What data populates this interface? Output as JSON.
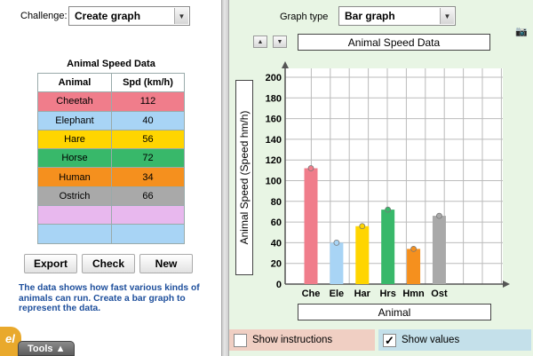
{
  "left": {
    "challenge_label": "Challenge:",
    "challenge_value": "Create graph",
    "table_title": "Animal Speed Data",
    "columns": [
      "Animal",
      "Spd (km/h)"
    ],
    "rows": [
      {
        "animal": "Cheetah",
        "speed": "112",
        "color": "#f07d8b"
      },
      {
        "animal": "Elephant",
        "speed": "40",
        "color": "#a8d4f5"
      },
      {
        "animal": "Hare",
        "speed": "56",
        "color": "#ffd500"
      },
      {
        "animal": "Horse",
        "speed": "72",
        "color": "#38b86a"
      },
      {
        "animal": "Human",
        "speed": "34",
        "color": "#f5901e"
      },
      {
        "animal": "Ostrich",
        "speed": "66",
        "color": "#a9a9a9"
      },
      {
        "animal": "",
        "speed": "",
        "color": "#e8b8ee"
      },
      {
        "animal": "",
        "speed": "",
        "color": "#a8d4f5"
      }
    ],
    "buttons": {
      "export": "Export",
      "check": "Check",
      "new": "New"
    },
    "description": "The data shows how fast various kinds of animals can run. Create a bar graph to represent the data.",
    "tools_label": "Tools ▲",
    "logo": "el"
  },
  "right": {
    "graph_type_label": "Graph type",
    "graph_type_value": "Bar graph",
    "show_instructions": "Show instructions",
    "show_values": "Show values",
    "show_values_checked": true
  },
  "chart_data": {
    "type": "bar",
    "title": "Animal Speed Data",
    "xlabel": "Animal",
    "ylabel": "Animal Speed (Speed hm/h)",
    "categories": [
      "Che",
      "Ele",
      "Har",
      "Hrs",
      "Hmn",
      "Ost"
    ],
    "values": [
      112,
      40,
      56,
      72,
      34,
      66
    ],
    "colors": [
      "#f07d8b",
      "#a8d4f5",
      "#ffd500",
      "#38b86a",
      "#f5901e",
      "#a9a9a9"
    ],
    "ylim": [
      0,
      200
    ],
    "yticks": [
      0,
      20,
      40,
      60,
      80,
      100,
      120,
      140,
      160,
      180,
      200
    ],
    "grid": true
  }
}
